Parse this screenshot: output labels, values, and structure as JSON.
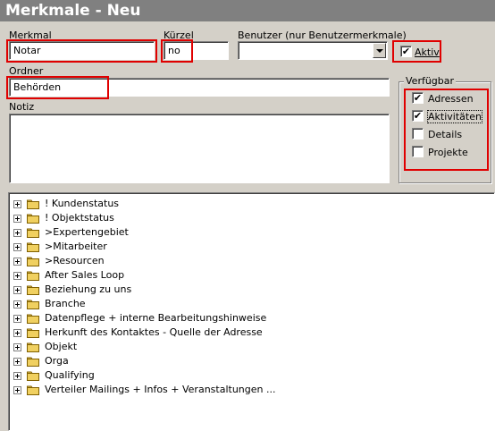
{
  "window": {
    "title": "Merkmale - Neu"
  },
  "form": {
    "merkmal": {
      "label": "Merkmal",
      "value": "Notar"
    },
    "kuerzel": {
      "label": "Kürzel",
      "value": "no"
    },
    "benutzer": {
      "label": "Benutzer (nur Benutzermerkmale)",
      "value": ""
    },
    "aktiv": {
      "label": "Aktiv",
      "checked": true
    },
    "ordner": {
      "label": "Ordner",
      "value": "Behörden"
    },
    "notiz": {
      "label": "Notiz",
      "value": ""
    }
  },
  "verfuegbar": {
    "label": "Verfügbar",
    "items": [
      {
        "label": "Adressen",
        "checked": true
      },
      {
        "label": "Aktivitäten",
        "checked": true
      },
      {
        "label": "Details",
        "checked": false
      },
      {
        "label": "Projekte",
        "checked": false
      }
    ]
  },
  "tree": {
    "items": [
      "! Kundenstatus",
      "! Objektstatus",
      ">Expertengebiet",
      ">Mitarbeiter",
      ">Resourcen",
      "After Sales Loop",
      "Beziehung zu uns",
      "Branche",
      "Datenpflege + interne Bearbeitungshinweise",
      "Herkunft des Kontaktes - Quelle der Adresse",
      "Objekt",
      "Orga",
      "Qualifying",
      "Verteiler Mailings + Infos + Veranstaltungen ..."
    ]
  },
  "colors": {
    "highlight": "#e00000",
    "folder": "#f0d060",
    "titlebar": "#808080"
  }
}
